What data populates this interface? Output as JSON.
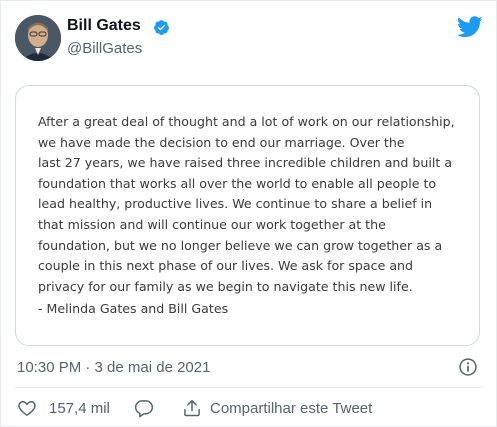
{
  "author": {
    "name": "Bill Gates",
    "handle": "@BillGates",
    "verified": true
  },
  "statement": {
    "body": "After a great deal of thought and a lot of work on our relationship,\nwe have made the decision to end our marriage. Over the\nlast 27 years, we have raised three incredible children and built a\nfoundation that works all over the world to enable all people to\nlead healthy, productive lives. We continue to share a belief in\nthat mission and will continue our work together at the\nfoundation, but we no longer believe we can grow together as a\ncouple in this next phase of our lives. We ask for space and\nprivacy for our family as we begin to navigate this new life.",
    "signature": "- Melinda Gates and Bill Gates"
  },
  "meta": {
    "timestamp": "10:30 PM · 3 de mai de 2021"
  },
  "actions": {
    "like_count": "157,4 mil",
    "share_label": "Compartilhar este Tweet"
  },
  "colors": {
    "twitter_blue": "#1d9bf0",
    "secondary_text": "#536471",
    "border": "#cfd9de"
  },
  "icons": [
    "verified-badge-icon",
    "twitter-bird-icon",
    "info-icon",
    "heart-icon",
    "reply-icon",
    "share-icon"
  ]
}
